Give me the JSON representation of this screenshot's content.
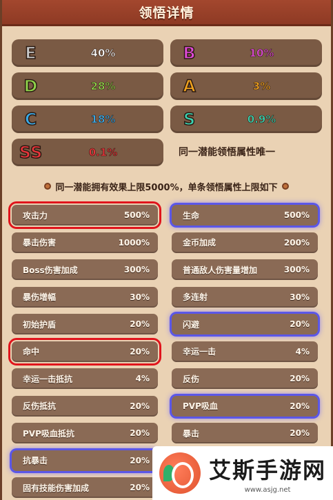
{
  "header": {
    "title": "领悟详情"
  },
  "ranks": [
    {
      "letter": "E",
      "value": "40%",
      "letter_color": "#c9c9c9",
      "value_color": "#ffffff"
    },
    {
      "letter": "B",
      "value": "10%",
      "letter_color": "#e04ad8",
      "value_color": "#e04ad8"
    },
    {
      "letter": "D",
      "value": "28%",
      "letter_color": "#8ed14a",
      "value_color": "#8ed14a"
    },
    {
      "letter": "A",
      "value": "3%",
      "letter_color": "#f0a21e",
      "value_color": "#f0a21e"
    },
    {
      "letter": "C",
      "value": "18%",
      "letter_color": "#3aa9e6",
      "value_color": "#3aa9e6"
    },
    {
      "letter": "S",
      "value": "0.9%",
      "letter_color": "#3ad2b0",
      "value_color": "#3ad2b0"
    },
    {
      "letter": "SS",
      "value": "0.1%",
      "letter_color": "#e8343a",
      "value_color": "#e8343a"
    }
  ],
  "unique_note": "同一潜能领悟属性唯一",
  "cap_note": "同一潜能拥有效果上限5000%，单条领悟属性上限如下",
  "stats": [
    {
      "name": "攻击力",
      "value": "500%",
      "highlight": "red"
    },
    {
      "name": "生命",
      "value": "500%",
      "highlight": "blue"
    },
    {
      "name": "暴击伤害",
      "value": "1000%",
      "highlight": ""
    },
    {
      "name": "金币加成",
      "value": "200%",
      "highlight": ""
    },
    {
      "name": "Boss伤害加成",
      "value": "300%",
      "highlight": ""
    },
    {
      "name": "普通敌人伤害量增加",
      "value": "300%",
      "highlight": ""
    },
    {
      "name": "暴伤增幅",
      "value": "30%",
      "highlight": ""
    },
    {
      "name": "多连射",
      "value": "30%",
      "highlight": ""
    },
    {
      "name": "初始护盾",
      "value": "20%",
      "highlight": ""
    },
    {
      "name": "闪避",
      "value": "20%",
      "highlight": "blue"
    },
    {
      "name": "命中",
      "value": "20%",
      "highlight": "red"
    },
    {
      "name": "幸运一击",
      "value": "4%",
      "highlight": ""
    },
    {
      "name": "幸运一击抵抗",
      "value": "4%",
      "highlight": ""
    },
    {
      "name": "反伤",
      "value": "20%",
      "highlight": ""
    },
    {
      "name": "反伤抵抗",
      "value": "20%",
      "highlight": ""
    },
    {
      "name": "PVP吸血",
      "value": "20%",
      "highlight": "blue"
    },
    {
      "name": "PVP吸血抵抗",
      "value": "20%",
      "highlight": ""
    },
    {
      "name": "暴击",
      "value": "20%",
      "highlight": ""
    },
    {
      "name": "抗暴击",
      "value": "20%",
      "highlight": "blue"
    },
    {
      "name": "",
      "value": "",
      "highlight": ""
    },
    {
      "name": "固有技能伤害加成",
      "value": "20%",
      "highlight": ""
    }
  ],
  "watermark": {
    "title": "艾斯手游网",
    "url": "www.asjg.net"
  }
}
